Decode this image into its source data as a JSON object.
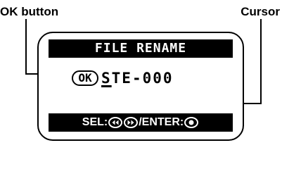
{
  "callouts": {
    "ok_button": "OK button",
    "cursor": "Cursor"
  },
  "screen": {
    "title": "FILE RENAME",
    "ok_badge": "OK",
    "filename_first": "S",
    "filename_rest": "TE-000",
    "help": {
      "sel_label": "SEL:",
      "separator": "/",
      "enter_label": "ENTER:",
      "icons": [
        "rewind-button-icon",
        "fast-forward-button-icon",
        "record-button-icon"
      ]
    }
  },
  "colors": {
    "foreground": "#000000",
    "background": "#ffffff"
  }
}
